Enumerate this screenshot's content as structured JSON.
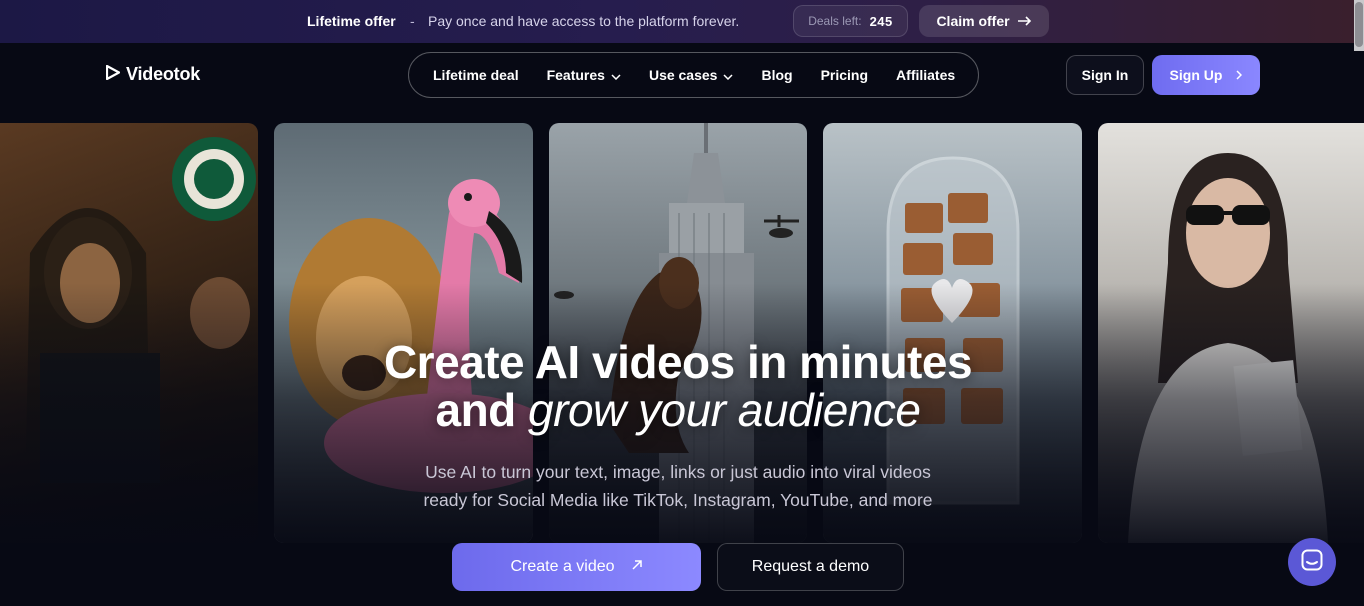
{
  "promo": {
    "title": "Lifetime offer",
    "separator": "-",
    "text": "Pay once and have access to the platform forever.",
    "deals_label": "Deals left:",
    "deals_value": "245",
    "claim_label": "Claim offer",
    "claim_icon": "arrow-right-icon"
  },
  "logo": {
    "text": "Videotok",
    "icon": "play-triangle-icon"
  },
  "nav": {
    "items": [
      {
        "label": "Lifetime deal",
        "has_dropdown": false
      },
      {
        "label": "Features",
        "has_dropdown": true
      },
      {
        "label": "Use cases",
        "has_dropdown": true
      },
      {
        "label": "Blog",
        "has_dropdown": false
      },
      {
        "label": "Pricing",
        "has_dropdown": false
      },
      {
        "label": "Affiliates",
        "has_dropdown": false
      }
    ],
    "signin_label": "Sign In",
    "signup_label": "Sign Up"
  },
  "hero": {
    "title_line1": "Create AI videos in minutes",
    "title_line2_plain": "and",
    "title_line2_italic": "grow your audience",
    "subtitle_line1": "Use AI to turn your text, image, links or just audio into viral videos",
    "subtitle_line2": "ready for Social Media like TikTok, Instagram, YouTube, and more",
    "cta_primary": "Create a video",
    "cta_secondary": "Request a demo"
  },
  "colors": {
    "background": "#070914",
    "accent": "#7b78f5",
    "promo_bar": "#1f1a48"
  }
}
